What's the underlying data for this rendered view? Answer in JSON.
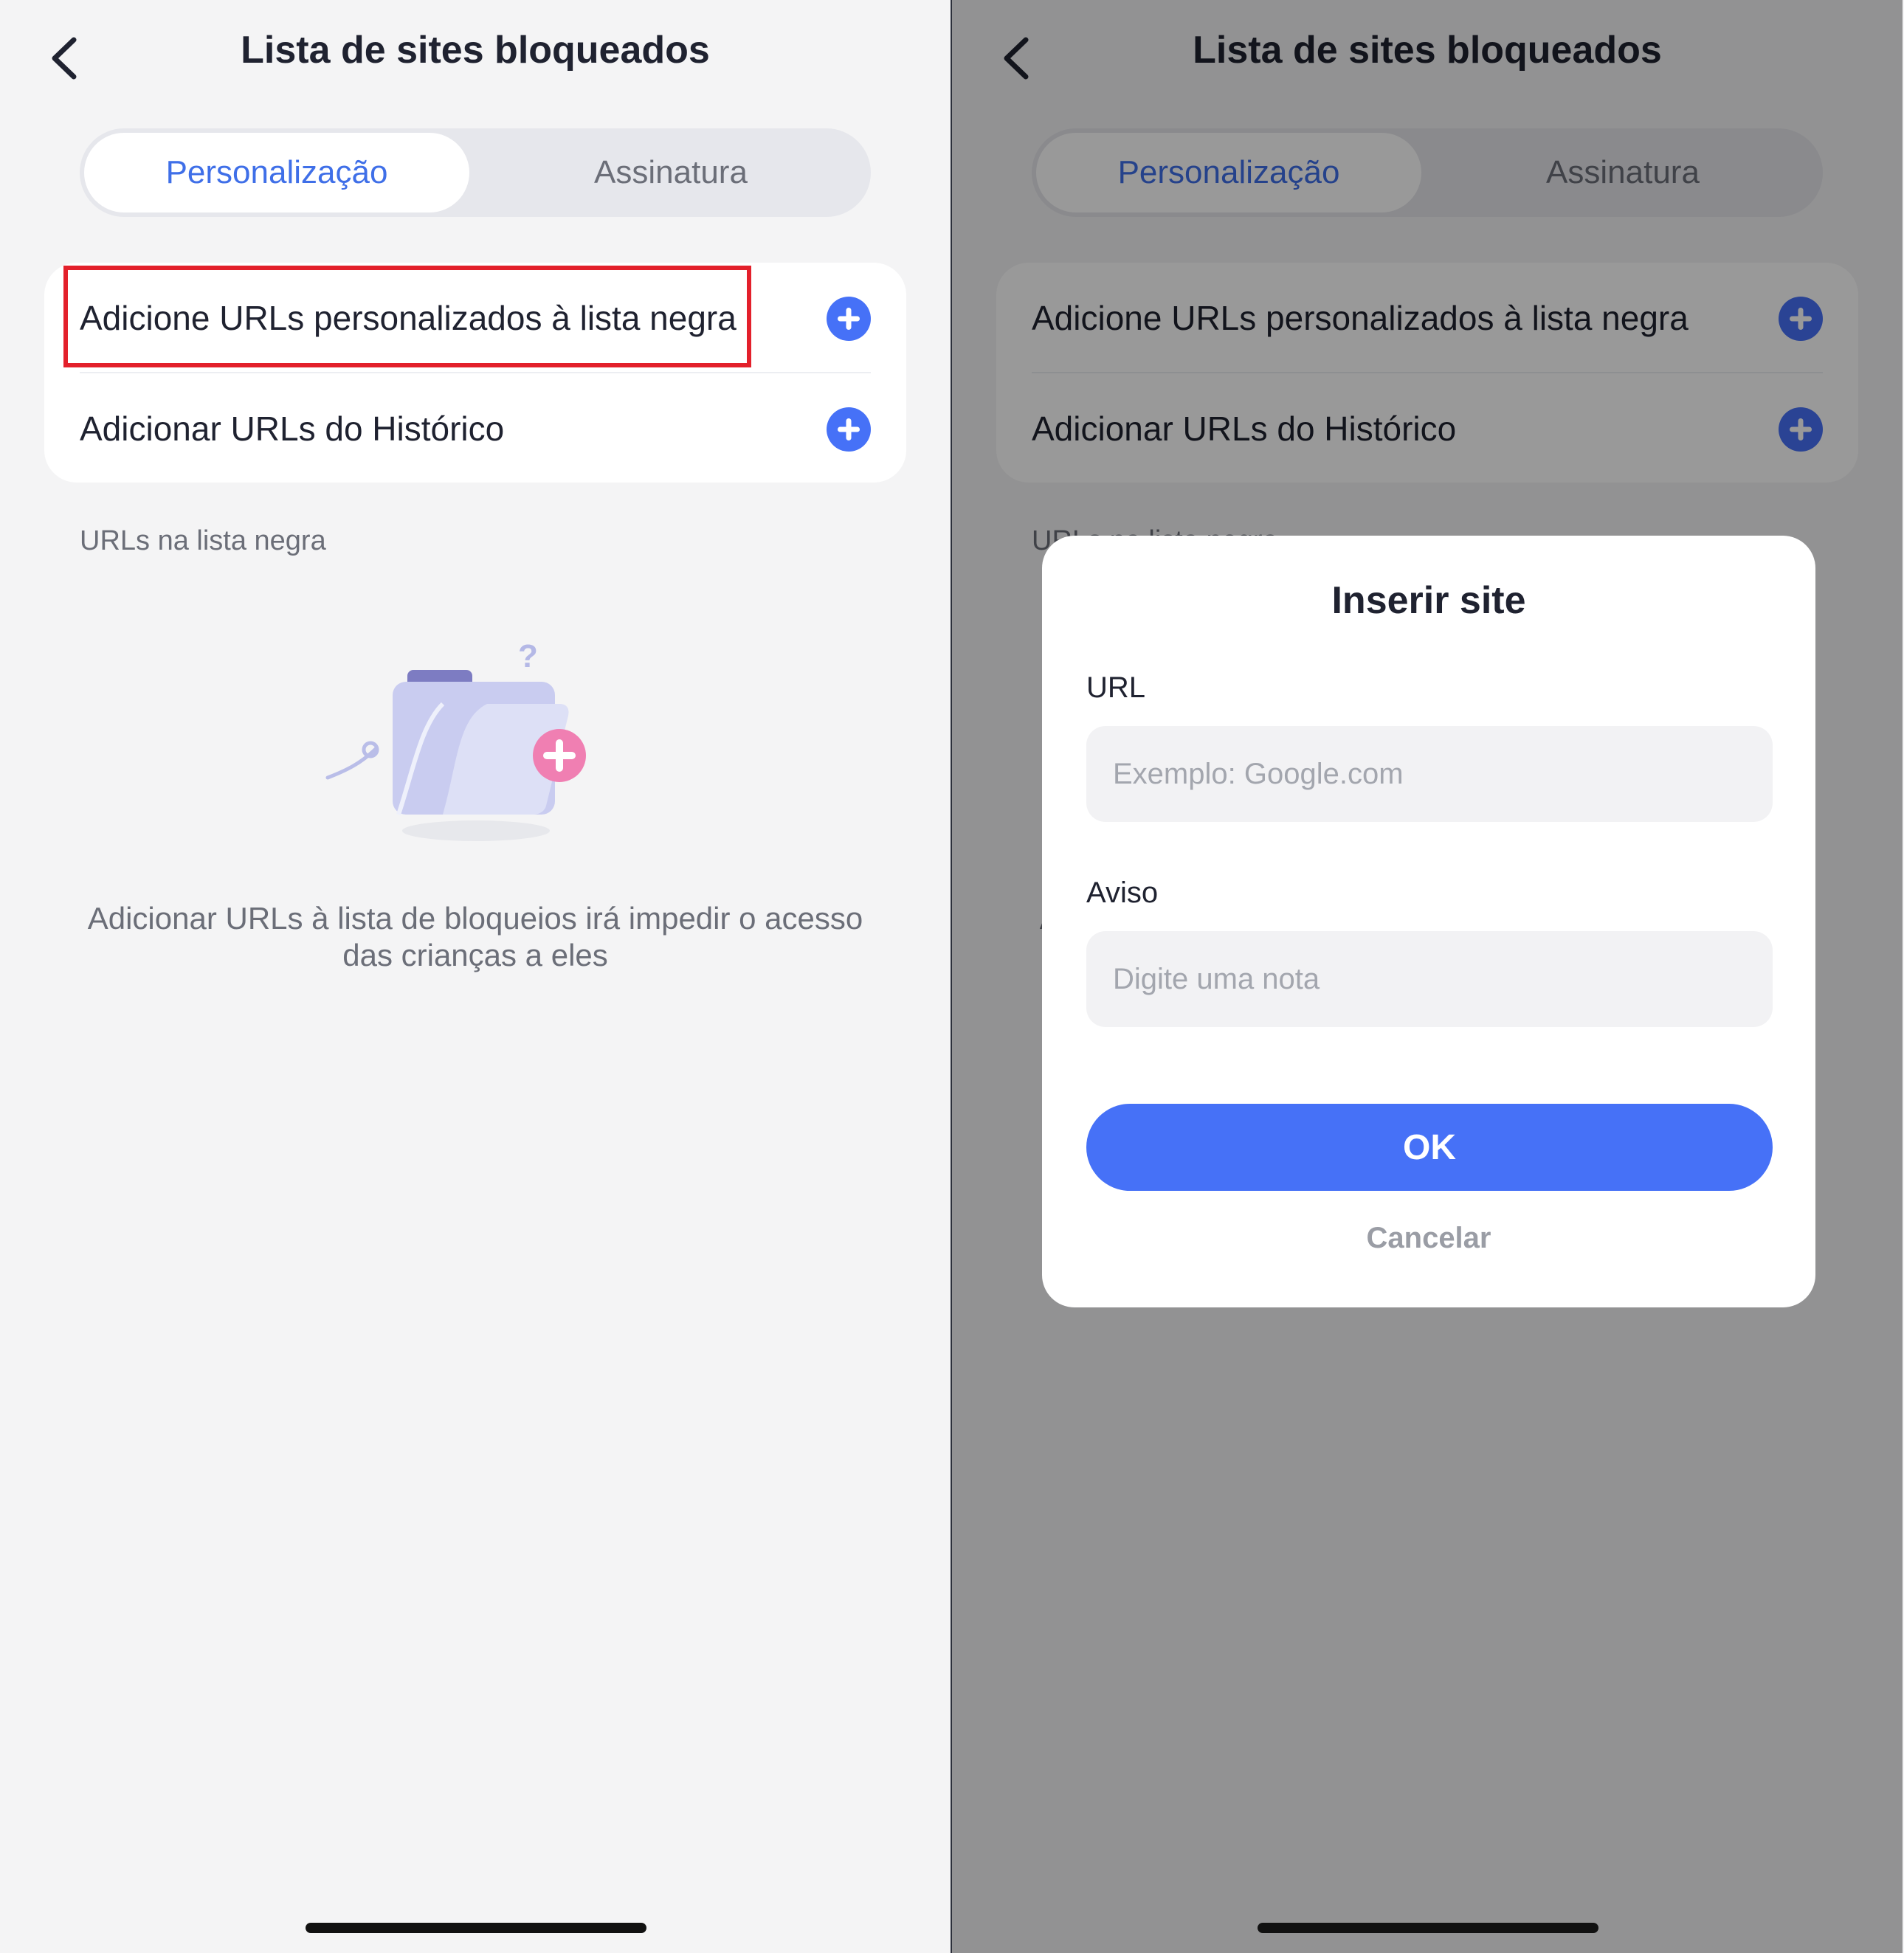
{
  "screen": {
    "title": "Lista de sites bloqueados",
    "tabs": [
      "Personalização",
      "Assinatura"
    ],
    "actions": [
      "Adicione URLs personalizados à lista negra",
      "Adicionar URLs do Histórico"
    ],
    "section_label": "URLs na lista negra",
    "empty_text": "Adicionar URLs à lista de bloqueios irá impedir o acesso das crianças a eles"
  },
  "dialog": {
    "title": "Inserir site",
    "url_label": "URL",
    "url_placeholder": "Exemplo: Google.com",
    "note_label": "Aviso",
    "note_placeholder": "Digite uma nota",
    "ok_label": "OK",
    "cancel_label": "Cancelar"
  },
  "icons": {
    "back": "chevron-left-icon",
    "add": "plus-circle-icon",
    "empty": "folder-add-illustration"
  },
  "colors": {
    "accent": "#4671f7",
    "tab_active_text": "#3f6fe8",
    "highlight": "#e3202b",
    "background": "#f4f4f5"
  }
}
